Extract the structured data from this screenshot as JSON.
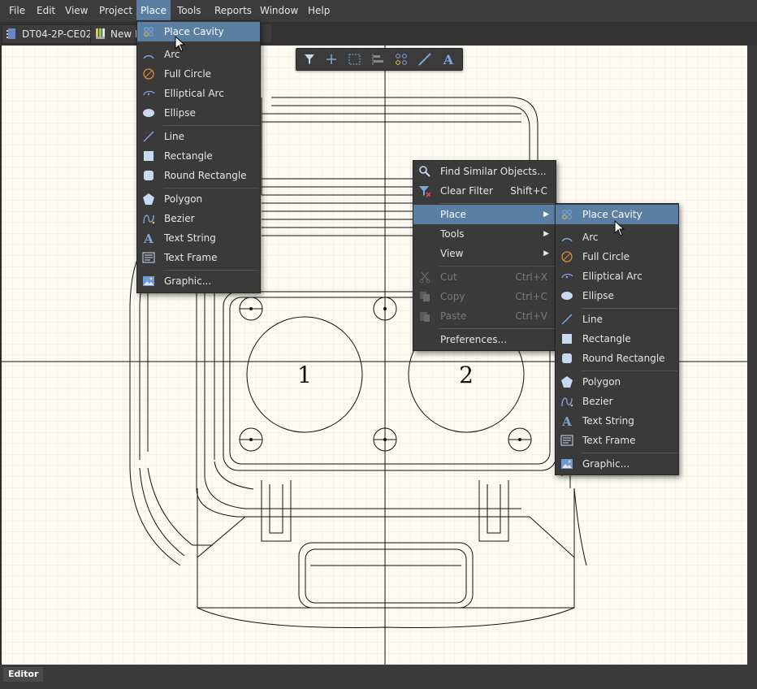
{
  "menubar": {
    "items": [
      "File",
      "Edit",
      "View",
      "Project",
      "Place",
      "Tools",
      "Reports",
      "Window",
      "Help"
    ]
  },
  "tabs": [
    {
      "label": "DT04-2P-CE02 *"
    },
    {
      "label": "New H"
    },
    {
      "label": "el"
    }
  ],
  "status": {
    "tab": "Editor"
  },
  "canvas": {
    "cavity_labels": [
      "1",
      "2"
    ]
  },
  "toolbar": {
    "icons": [
      "filter-icon",
      "cross-hair-icon",
      "select-rect-icon",
      "align-icon",
      "place-cavity-icon",
      "line-icon",
      "text-icon"
    ]
  },
  "place_menu": {
    "items": [
      {
        "label": "Place Cavity",
        "icon": "place-cavity-icon"
      },
      {
        "label": "Arc",
        "icon": "arc-icon"
      },
      {
        "label": "Full Circle",
        "icon": "full-circle-icon"
      },
      {
        "label": "Elliptical Arc",
        "icon": "elliptical-arc-icon"
      },
      {
        "label": "Ellipse",
        "icon": "ellipse-icon"
      },
      {
        "label": "Line",
        "icon": "line-icon"
      },
      {
        "label": "Rectangle",
        "icon": "rectangle-icon"
      },
      {
        "label": "Round Rectangle",
        "icon": "round-rectangle-icon"
      },
      {
        "label": "Polygon",
        "icon": "polygon-icon"
      },
      {
        "label": "Bezier",
        "icon": "bezier-icon"
      },
      {
        "label": "Text String",
        "icon": "text-string-icon"
      },
      {
        "label": "Text Frame",
        "icon": "text-frame-icon"
      },
      {
        "label": "Graphic...",
        "icon": "graphic-icon"
      }
    ]
  },
  "context_menu": {
    "items": [
      {
        "label": "Find Similar Objects...",
        "shortcut": "",
        "icon": "find-similar-icon"
      },
      {
        "label": "Clear Filter",
        "shortcut": "Shift+C",
        "icon": "clear-filter-icon"
      },
      {
        "label": "Place",
        "shortcut": "",
        "icon": ""
      },
      {
        "label": "Tools",
        "shortcut": "",
        "icon": ""
      },
      {
        "label": "View",
        "shortcut": "",
        "icon": ""
      },
      {
        "label": "Cut",
        "shortcut": "Ctrl+X",
        "icon": "cut-icon"
      },
      {
        "label": "Copy",
        "shortcut": "Ctrl+C",
        "icon": "copy-icon"
      },
      {
        "label": "Paste",
        "shortcut": "Ctrl+V",
        "icon": "paste-icon"
      },
      {
        "label": "Preferences...",
        "shortcut": "",
        "icon": ""
      }
    ]
  },
  "submenu": {
    "items": [
      {
        "label": "Place Cavity"
      },
      {
        "label": "Arc"
      },
      {
        "label": "Full Circle"
      },
      {
        "label": "Elliptical Arc"
      },
      {
        "label": "Ellipse"
      },
      {
        "label": "Line"
      },
      {
        "label": "Rectangle"
      },
      {
        "label": "Round Rectangle"
      },
      {
        "label": "Polygon"
      },
      {
        "label": "Bezier"
      },
      {
        "label": "Text String"
      },
      {
        "label": "Text Frame"
      },
      {
        "label": "Graphic..."
      }
    ]
  }
}
